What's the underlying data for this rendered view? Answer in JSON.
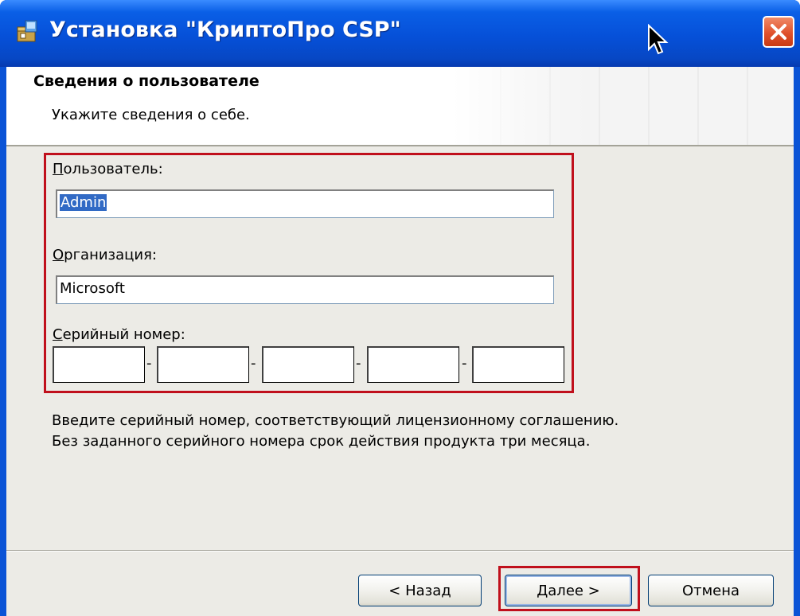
{
  "window": {
    "title": "Установка \"КриптоПро CSP\""
  },
  "header": {
    "title": "Сведения о пользователе",
    "subtitle": "Укажите сведения о себе."
  },
  "form": {
    "user_label_mnemonic": "П",
    "user_label_rest": "ользователь:",
    "user_value": "Admin",
    "org_label_mnemonic": "О",
    "org_label_rest": "рганизация:",
    "org_value": "Microsoft",
    "serial_label_mnemonic": "С",
    "serial_label_rest": "ерийный номер:",
    "serial_separator": "-",
    "serial_parts": [
      "",
      "",
      "",
      "",
      ""
    ]
  },
  "info": {
    "line1": "Введите серийный номер, соответствующий лицензионному соглашению.",
    "line2": "Без заданного серийного номера срок действия продукта три месяца."
  },
  "buttons": {
    "back": "< Назад",
    "next": "Далее >",
    "cancel": "Отмена"
  },
  "icons": {
    "app": "installer-package-icon",
    "close": "close-icon",
    "cursor": "mouse-pointer-icon"
  },
  "colors": {
    "titlebar": "#0650d8",
    "highlight": "#c0101c",
    "selection": "#316ac5",
    "close": "#e0512c"
  }
}
